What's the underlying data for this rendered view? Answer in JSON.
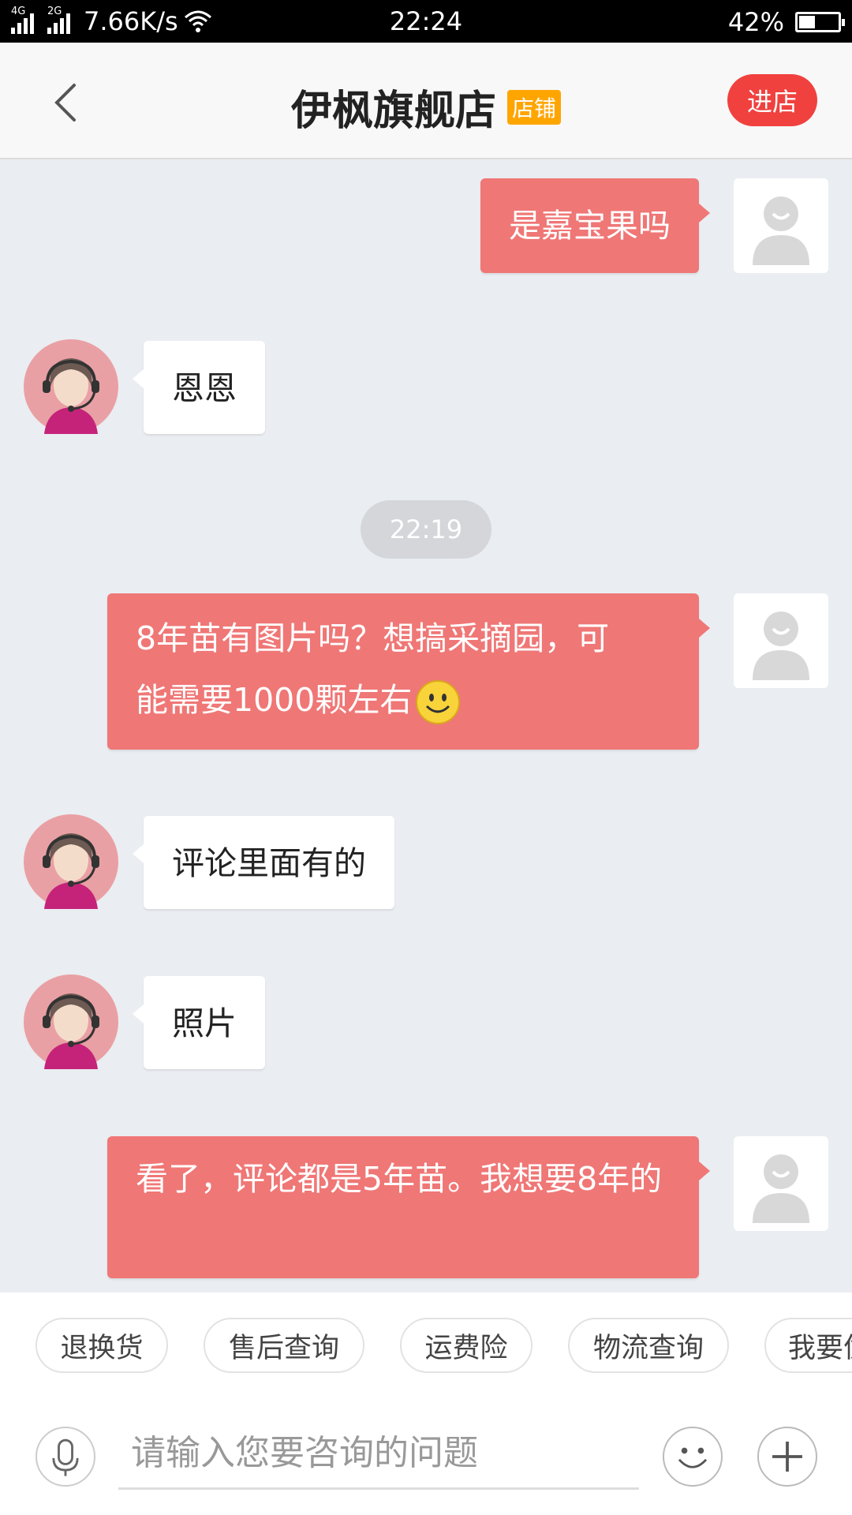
{
  "status_bar": {
    "net_type_1": "4G",
    "net_type_2": "2G",
    "speed": "7.66K/s",
    "time": "22:24",
    "battery": "42%",
    "battery_level": 0.42
  },
  "header": {
    "title": "伊枫旗舰店",
    "tag": "店铺",
    "enter_label": "进店"
  },
  "messages": [
    {
      "from": "user",
      "text": "是嘉宝果吗"
    },
    {
      "from": "agent",
      "text": "恩恩"
    },
    {
      "type": "time",
      "text": "22:19"
    },
    {
      "from": "user",
      "text_line1": "8年苗有图片吗？想搞采摘园，可",
      "text_line2": "能需要1000颗左右",
      "emoji": "smiley-emoji"
    },
    {
      "from": "agent",
      "text": "评论里面有的"
    },
    {
      "from": "agent",
      "text": "照片"
    },
    {
      "from": "user",
      "text": "看了，评论都是5年苗。我想要8年的"
    }
  ],
  "quick_replies": [
    "退换货",
    "售后查询",
    "运费险",
    "物流查询",
    "我要优惠"
  ],
  "input": {
    "placeholder": "请输入您要咨询的问题"
  },
  "colors": {
    "user_bubble": "#ef7776",
    "enter_button": "#f0413f",
    "shop_tag": "#ffa500"
  }
}
